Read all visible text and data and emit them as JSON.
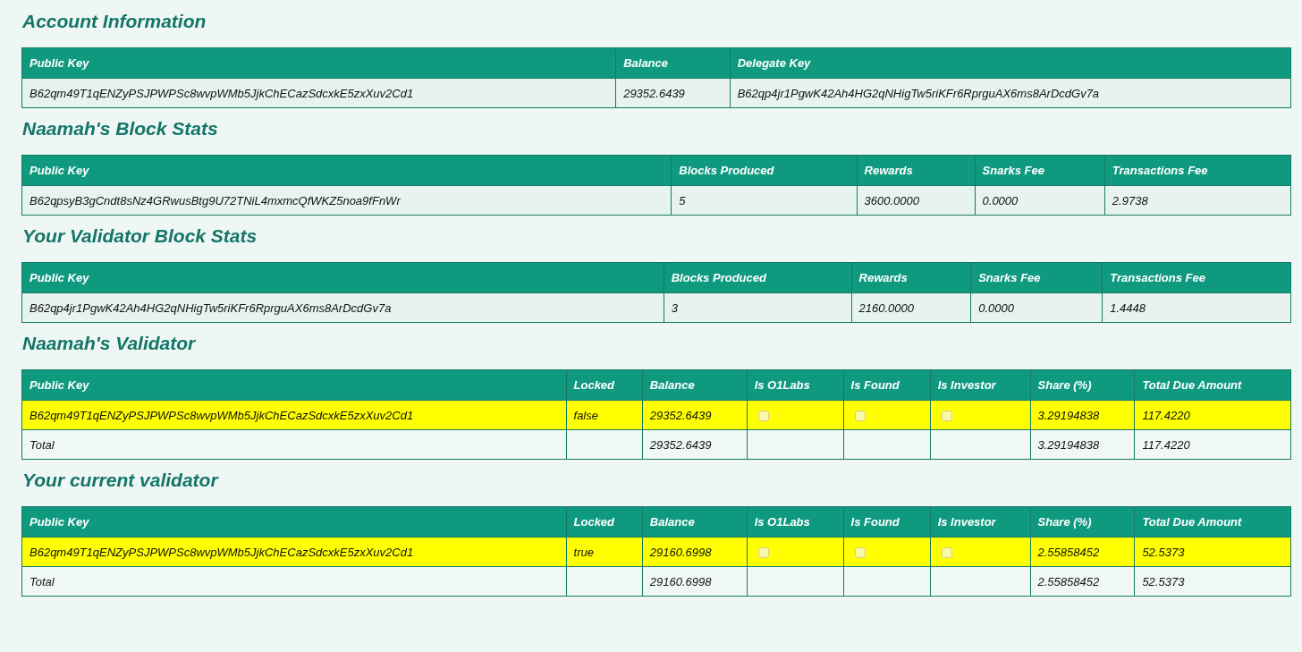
{
  "sections": [
    {
      "title": "Account Information",
      "columns": [
        "Public Key",
        "Balance",
        "Delegate Key"
      ],
      "rows": [
        {
          "kind": "data",
          "highlighted": false,
          "cells": [
            "B62qm49T1qENZyPSJPWPSc8wvpWMb5JjkChECazSdcxkE5zxXuv2Cd1",
            "29352.6439",
            "B62qp4jr1PgwK42Ah4HG2qNHigTw5riKFr6RprguAX6ms8ArDcdGv7a"
          ]
        }
      ]
    },
    {
      "title": "Naamah's Block Stats",
      "columns": [
        "Public Key",
        "Blocks Produced",
        "Rewards",
        "Snarks Fee",
        "Transactions Fee"
      ],
      "rows": [
        {
          "kind": "data",
          "highlighted": false,
          "cells": [
            "B62qpsyB3gCndt8sNz4GRwusBtg9U72TNiL4mxmcQfWKZ5noa9fFnWr",
            "5",
            "3600.0000",
            "0.0000",
            "2.9738"
          ]
        }
      ]
    },
    {
      "title": "Your Validator Block Stats",
      "columns": [
        "Public Key",
        "Blocks Produced",
        "Rewards",
        "Snarks Fee",
        "Transactions Fee"
      ],
      "rows": [
        {
          "kind": "data",
          "highlighted": false,
          "cells": [
            "B62qp4jr1PgwK42Ah4HG2qNHigTw5riKFr6RprguAX6ms8ArDcdGv7a",
            "3",
            "2160.0000",
            "0.0000",
            "1.4448"
          ]
        }
      ]
    },
    {
      "title": "Naamah's Validator",
      "columns": [
        "Public Key",
        "Locked",
        "Balance",
        "Is O1Labs",
        "Is Found",
        "Is Investor",
        "Share (%)",
        "Total Due Amount"
      ],
      "rows": [
        {
          "kind": "data",
          "highlighted": true,
          "cells": [
            "B62qm49T1qENZyPSJPWPSc8wvpWMb5JjkChECazSdcxkE5zxXuv2Cd1",
            "false",
            "29352.6439",
            {
              "checked": false
            },
            {
              "checked": false
            },
            {
              "checked": false
            },
            "3.29194838",
            "117.4220"
          ]
        },
        {
          "kind": "total",
          "highlighted": false,
          "cells": [
            "Total",
            null,
            "29352.6439",
            null,
            null,
            null,
            "3.29194838",
            "117.4220"
          ]
        }
      ]
    },
    {
      "title": "Your current validator",
      "columns": [
        "Public Key",
        "Locked",
        "Balance",
        "Is O1Labs",
        "Is Found",
        "Is Investor",
        "Share (%)",
        "Total Due Amount"
      ],
      "rows": [
        {
          "kind": "data",
          "highlighted": true,
          "cells": [
            "B62qm49T1qENZyPSJPWPSc8wvpWMb5JjkChECazSdcxkE5zxXuv2Cd1",
            "true",
            "29160.6998",
            {
              "checked": false
            },
            {
              "checked": false
            },
            {
              "checked": false
            },
            "2.55858452",
            "52.5373"
          ]
        },
        {
          "kind": "total",
          "highlighted": false,
          "cells": [
            "Total",
            null,
            "29160.6998",
            null,
            null,
            null,
            "2.55858452",
            "52.5373"
          ]
        }
      ]
    }
  ]
}
